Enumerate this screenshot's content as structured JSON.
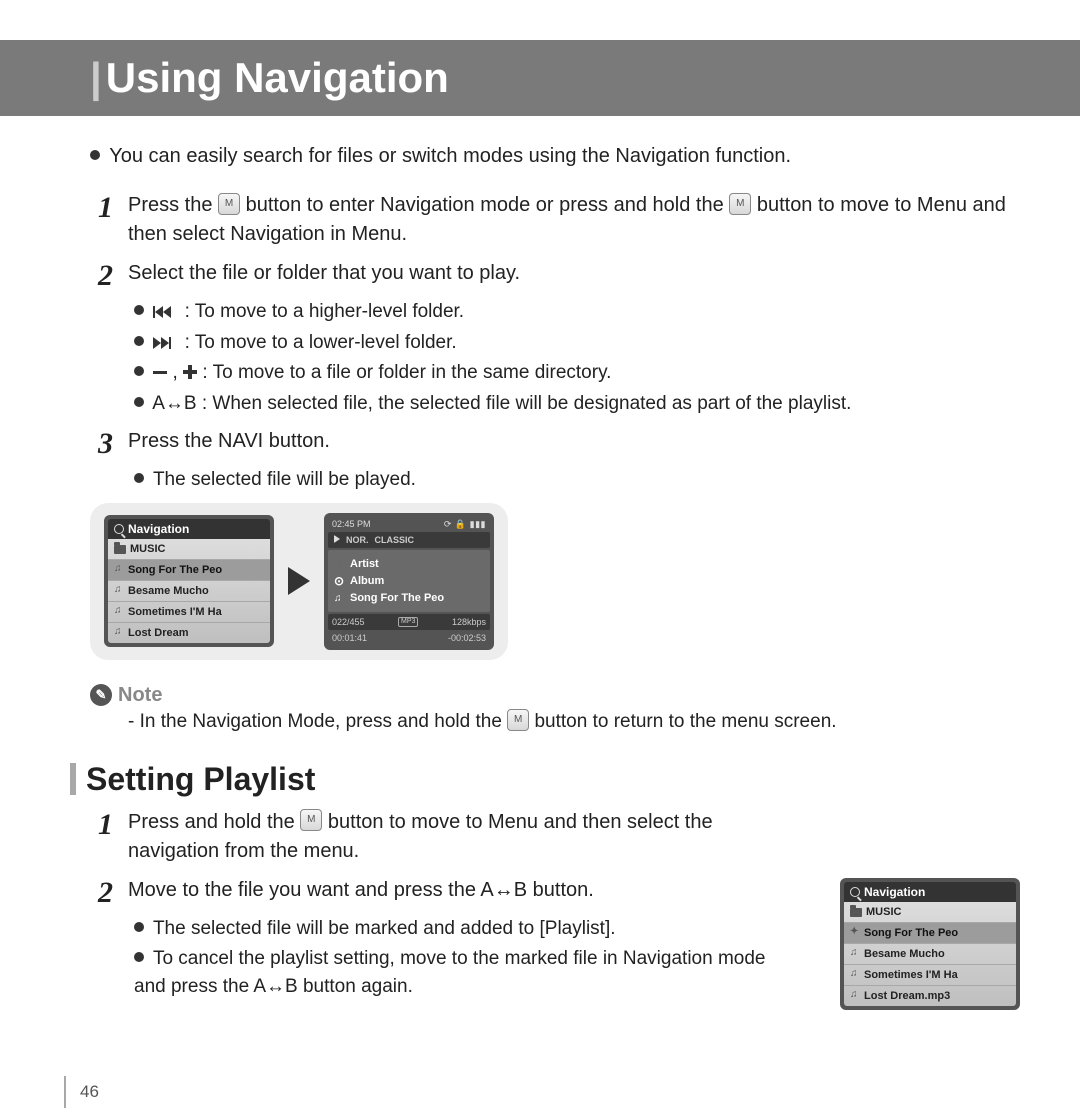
{
  "title": "Using Navigation",
  "intro": "You can easily search for files or switch modes using the Navigation function.",
  "steps": {
    "s1a": "Press the ",
    "s1b": " button to enter Navigation mode or press and hold the ",
    "s1c": " button to move to Menu and then select Navigation in Menu.",
    "s2": "Select the file or folder that you want to play.",
    "s2_sub": {
      "a": ": To move to a higher-level folder.",
      "b": ": To move to a lower-level folder.",
      "c": ": To move to a file or folder in the same directory.",
      "d": "A↔B : When selected file, the selected file will be designated as part of the playlist."
    },
    "s3": "Press the NAVI button.",
    "s3_sub": "The selected file will be played."
  },
  "device1": {
    "title": "Navigation",
    "folder": "MUSIC",
    "items": [
      "Song For The Peo",
      "Besame Mucho",
      "Sometimes I'M Ha",
      "Lost Dream"
    ]
  },
  "player": {
    "time_top": "02:45 PM",
    "nor": "NOR.",
    "classic": "CLASSIC",
    "artist": "Artist",
    "album": "Album",
    "song": "Song For The Peo",
    "track": "022/455",
    "format": "MP3",
    "bitrate": "128kbps",
    "elapsed": "00:01:41",
    "remain": "-00:02:53"
  },
  "note": {
    "label": "Note",
    "t1": "- In the Navigation Mode, press and hold the ",
    "t2": " button to return to the menu screen."
  },
  "sub_title": "Setting Playlist",
  "playlist": {
    "s1a": "Press and hold the ",
    "s1b": " button to move to Menu and then select the navigation from the menu.",
    "s2": "Move to the file you want and press the A↔B button.",
    "s2_sub_a": "The selected file will be marked and added to [Playlist].",
    "s2_sub_b": "To cancel the playlist setting, move to the marked file in Navigation mode and press the A↔B button again."
  },
  "device2": {
    "title": "Navigation",
    "folder": "MUSIC",
    "items": [
      "Song For The Peo",
      "Besame Mucho",
      "Sometimes I'M Ha",
      "Lost Dream.mp3"
    ]
  },
  "page": "46",
  "m_label": "M"
}
